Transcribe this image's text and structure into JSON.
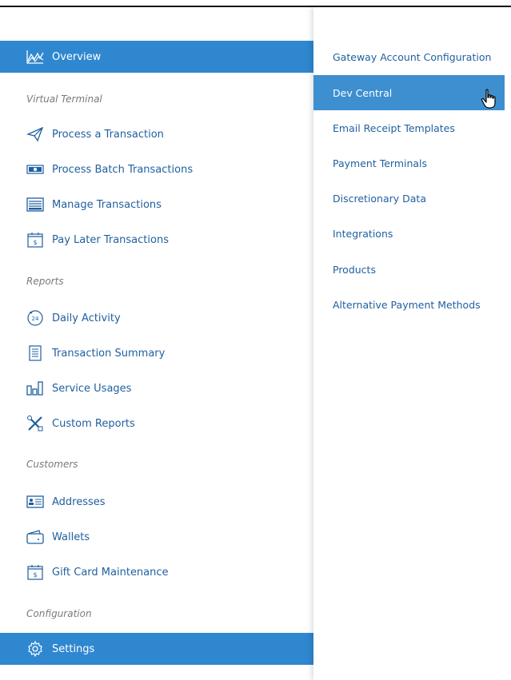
{
  "nav": {
    "overview": "Overview",
    "sections": {
      "virtual_terminal": "Virtual Terminal",
      "reports": "Reports",
      "customers": "Customers",
      "configuration": "Configuration"
    },
    "items": {
      "process_transaction": "Process a Transaction",
      "process_batch": "Process Batch Transactions",
      "manage_transactions": "Manage Transactions",
      "pay_later": "Pay Later Transactions",
      "daily_activity": "Daily Activity",
      "transaction_summary": "Transaction Summary",
      "service_usages": "Service Usages",
      "custom_reports": "Custom Reports",
      "addresses": "Addresses",
      "wallets": "Wallets",
      "gift_card": "Gift Card Maintenance",
      "settings": "Settings"
    },
    "icon_text": {
      "daily_24": "24",
      "dollar": "$"
    }
  },
  "submenu": [
    "Gateway Account Configuration",
    "Dev Central",
    "Email Receipt Templates",
    "Payment Terminals",
    "Discretionary Data",
    "Integrations",
    "Products",
    "Alternative Payment Methods"
  ],
  "colors": {
    "accent": "#2f87d0",
    "submenu_active": "#3d8fd0",
    "link": "#1f5f9f"
  },
  "icons": [
    "overview-chart-icon",
    "paper-plane-icon",
    "batch-cash-icon",
    "stack-icon",
    "calendar-dollar-icon",
    "clock-24-icon",
    "document-icon",
    "bar-chart-icon",
    "tools-icon",
    "address-card-icon",
    "wallet-icon",
    "gear-icon",
    "hand-cursor-icon"
  ]
}
